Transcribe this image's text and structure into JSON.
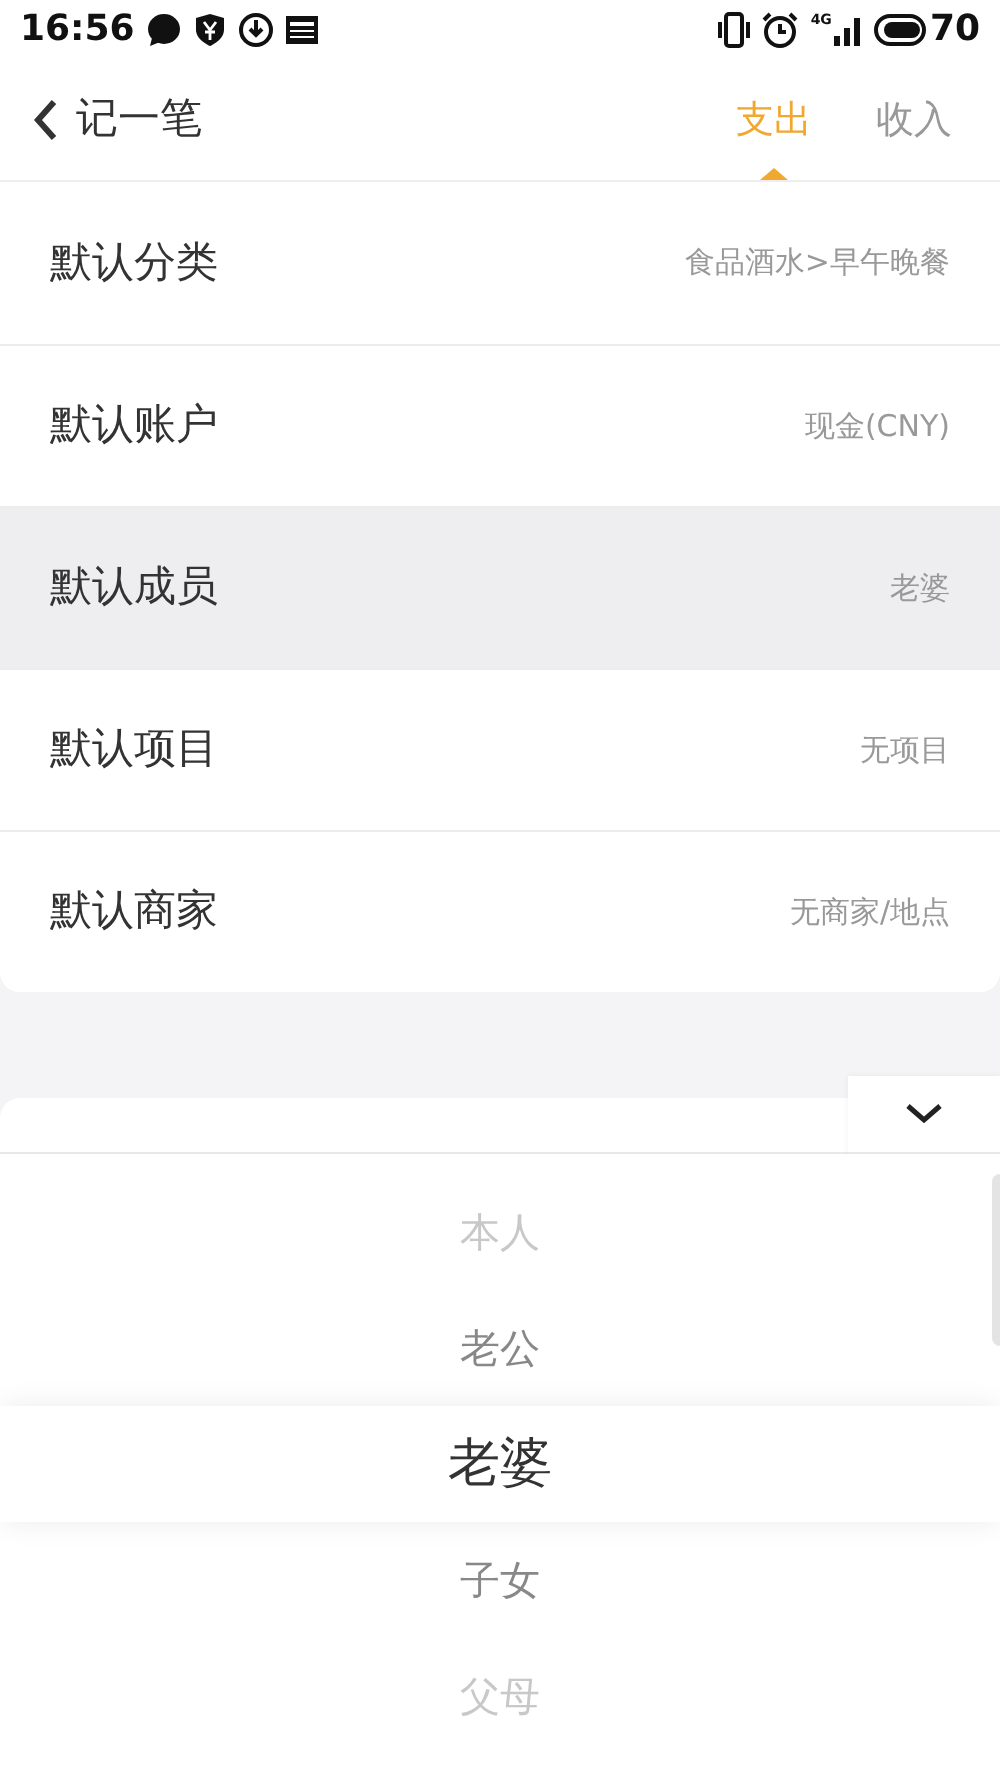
{
  "status_bar": {
    "time": "16:56",
    "network": "4G",
    "battery": "70"
  },
  "header": {
    "title": "记一笔",
    "tabs": [
      {
        "label": "支出",
        "selected": true
      },
      {
        "label": "收入",
        "selected": false
      }
    ]
  },
  "settings": [
    {
      "label": "默认分类",
      "value": "食品酒水>早午晚餐",
      "selected": false
    },
    {
      "label": "默认账户",
      "value": "现金(CNY)",
      "selected": false
    },
    {
      "label": "默认成员",
      "value": "老婆",
      "selected": true
    },
    {
      "label": "默认项目",
      "value": "无项目",
      "selected": false
    },
    {
      "label": "默认商家",
      "value": "无商家/地点",
      "selected": false
    }
  ],
  "picker": {
    "options": [
      {
        "label": "本人",
        "selected": false
      },
      {
        "label": "老公",
        "selected": false
      },
      {
        "label": "老婆",
        "selected": true
      },
      {
        "label": "子女",
        "selected": false
      },
      {
        "label": "父母",
        "selected": false
      }
    ]
  }
}
